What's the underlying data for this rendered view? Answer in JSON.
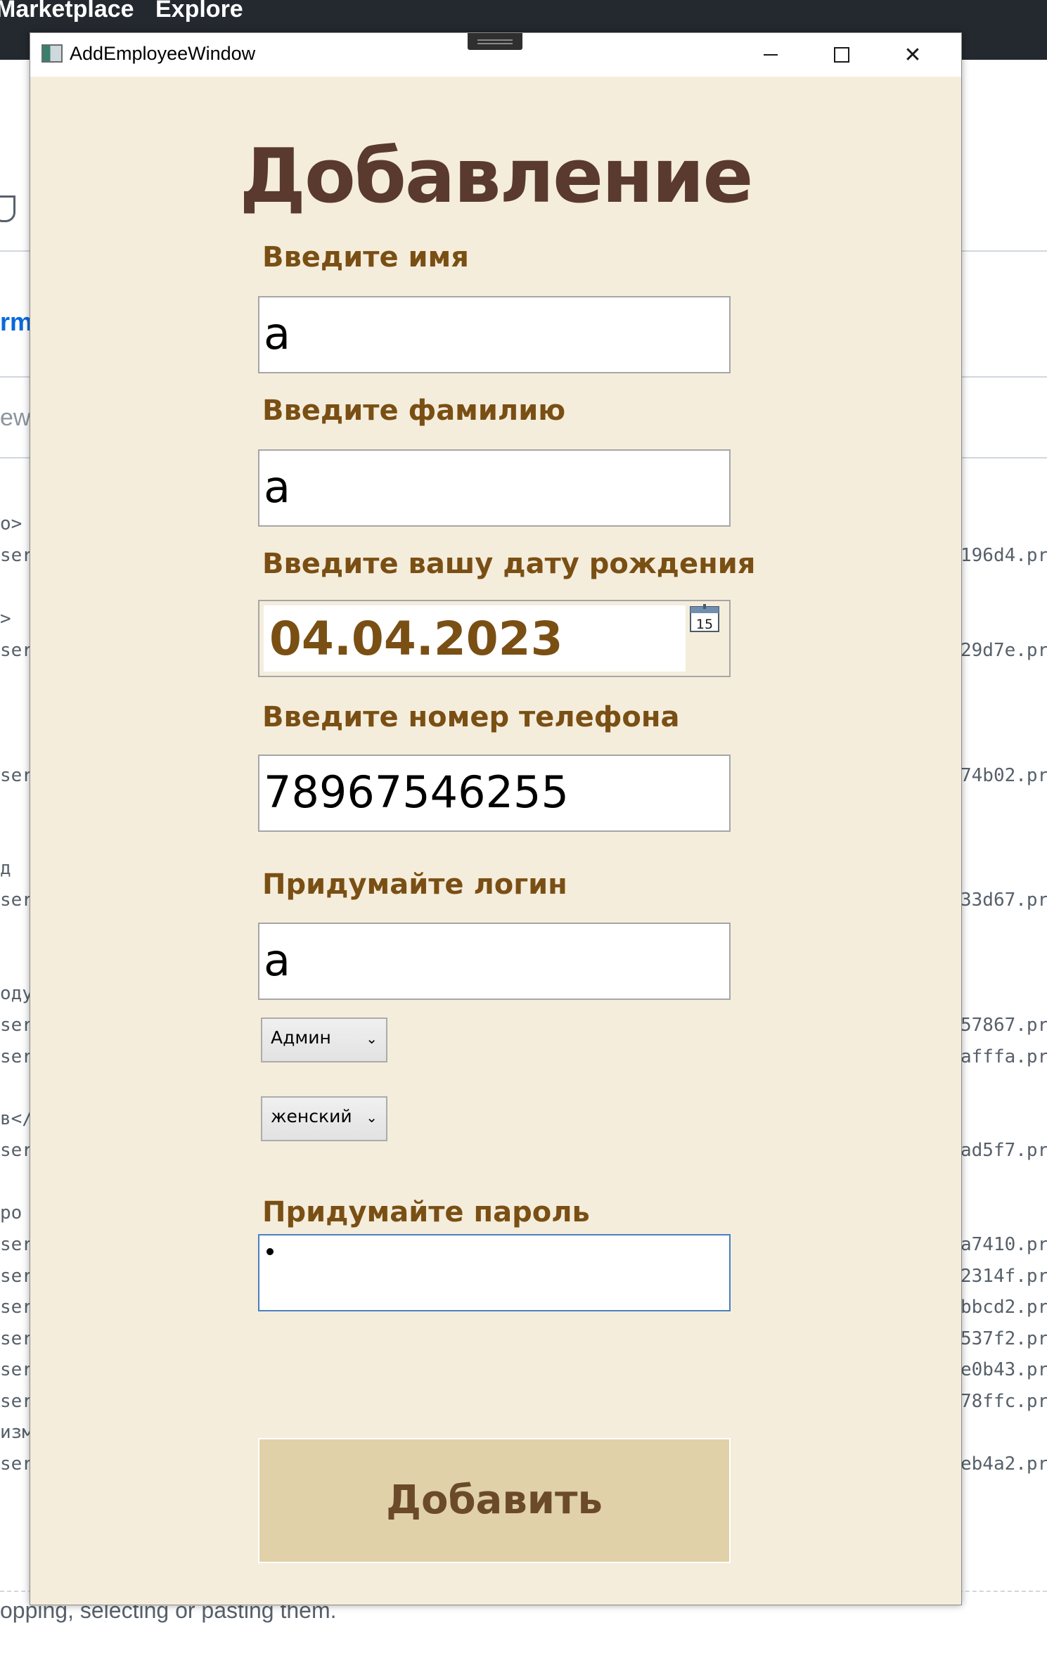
{
  "background": {
    "nav_items": [
      "Marketplace",
      "Explore"
    ],
    "link_fragment": "rm",
    "grey_fragment": "ew",
    "left_fragments": [
      "o>",
      "ser",
      ">",
      "ser",
      "ser",
      "д",
      "ser",
      "оду",
      "ser",
      "ser",
      "в</",
      "ser",
      "ро",
      "ser",
      "ser",
      "ser",
      "ser",
      "ser",
      "ser",
      "изм",
      "ser"
    ],
    "right_fragments": [
      "196d4.pr",
      "29d7e.pr",
      "74b02.pr",
      "33d67.pr",
      "57867.pr",
      "afffa.pr",
      "ad5f7.pr",
      "a7410.pr",
      "2314f.pr",
      "bbcd2.pr",
      "537f2.pr",
      "e0b43.pr",
      "78ffc.pr",
      "eb4a2.pr"
    ],
    "footer_text": "opping, selecting or pasting them."
  },
  "window": {
    "title": "AddEmployeeWindow",
    "heading": "Добавление",
    "first_name": {
      "label": "Введите имя",
      "value": "а"
    },
    "last_name": {
      "label": "Введите фамилию",
      "value": "а"
    },
    "birth_date": {
      "label": "Введите вашу дату рождения",
      "value": "04.04.2023",
      "calendar_day": "15"
    },
    "phone": {
      "label": "Введите номер телефона",
      "value": "78967546255"
    },
    "login": {
      "label": "Придумайте логин",
      "value": "а"
    },
    "role_select": {
      "value": "Админ"
    },
    "gender_select": {
      "value": "женский"
    },
    "password": {
      "label": "Придумайте пароль",
      "value": "•"
    },
    "submit_label": "Добавить"
  },
  "colors": {
    "window_bg": "#f5eddc",
    "heading": "#5a3a2e",
    "label": "#7a4f14",
    "button_bg": "#e0d1a8"
  }
}
